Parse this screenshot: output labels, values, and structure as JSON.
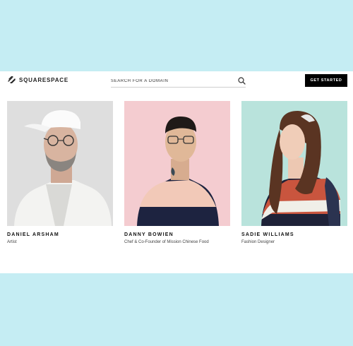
{
  "brand": {
    "name": "SQUARESPACE"
  },
  "search": {
    "placeholder": "SEARCH FOR A DOMAIN",
    "icon": "search-icon"
  },
  "cta": {
    "label": "GET STARTED"
  },
  "people": [
    {
      "name": "DANIEL ARSHAM",
      "role": "Artist",
      "bg": "#dedede"
    },
    {
      "name": "DANNY BOWIEN",
      "role": "Chef & Co-Founder of Mission Chinese Food",
      "bg": "#f4ccd0"
    },
    {
      "name": "SADIE WILLIAMS",
      "role": "Fashion Designer",
      "bg": "#b9e3dc"
    }
  ],
  "colors": {
    "page_bg": "#c5edf3",
    "panel_bg": "#ffffff",
    "button_bg": "#000000"
  }
}
